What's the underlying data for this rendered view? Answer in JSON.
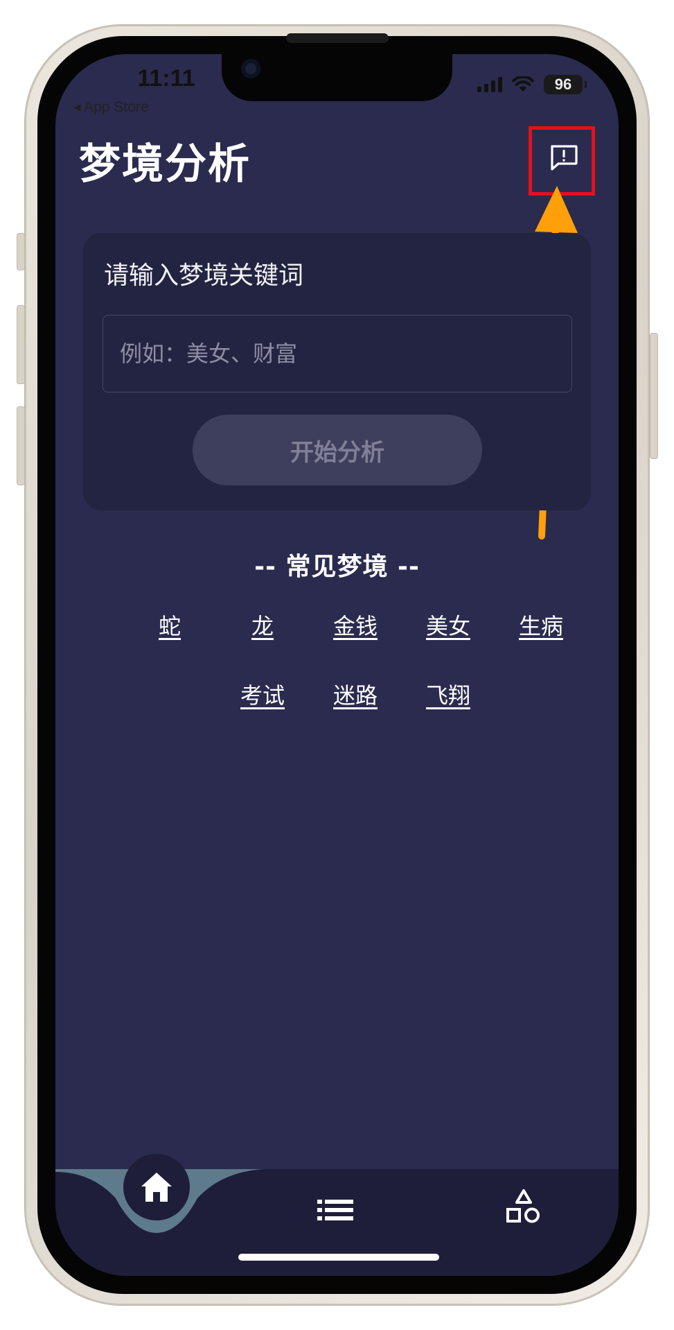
{
  "status_bar": {
    "time": "11:11",
    "back_label": "◂ App Store",
    "battery": "96"
  },
  "header": {
    "title": "梦境分析",
    "feedback_icon": "feedback-message-icon"
  },
  "annotation": {
    "highlight_color": "#e3101d",
    "arrow_color": "#ff9f0a"
  },
  "search_card": {
    "label": "请输入梦境关键词",
    "input_value": "",
    "input_placeholder": "例如：美女、财富",
    "submit_label": "开始分析"
  },
  "common_dreams": {
    "title": "-- 常见梦境 --",
    "items": [
      "蛇",
      "龙",
      "金钱",
      "美女",
      "生病",
      "考试",
      "迷路",
      "飞翔"
    ]
  },
  "tab_bar": {
    "tabs": [
      {
        "icon": "home-icon",
        "active": true
      },
      {
        "icon": "list-icon",
        "active": false
      },
      {
        "icon": "shapes-icon",
        "active": false
      }
    ],
    "active_color": "#5e7b8c"
  },
  "colors": {
    "background": "#2a2b4e",
    "card": "#232441",
    "tabbar": "#1e1e3a"
  }
}
